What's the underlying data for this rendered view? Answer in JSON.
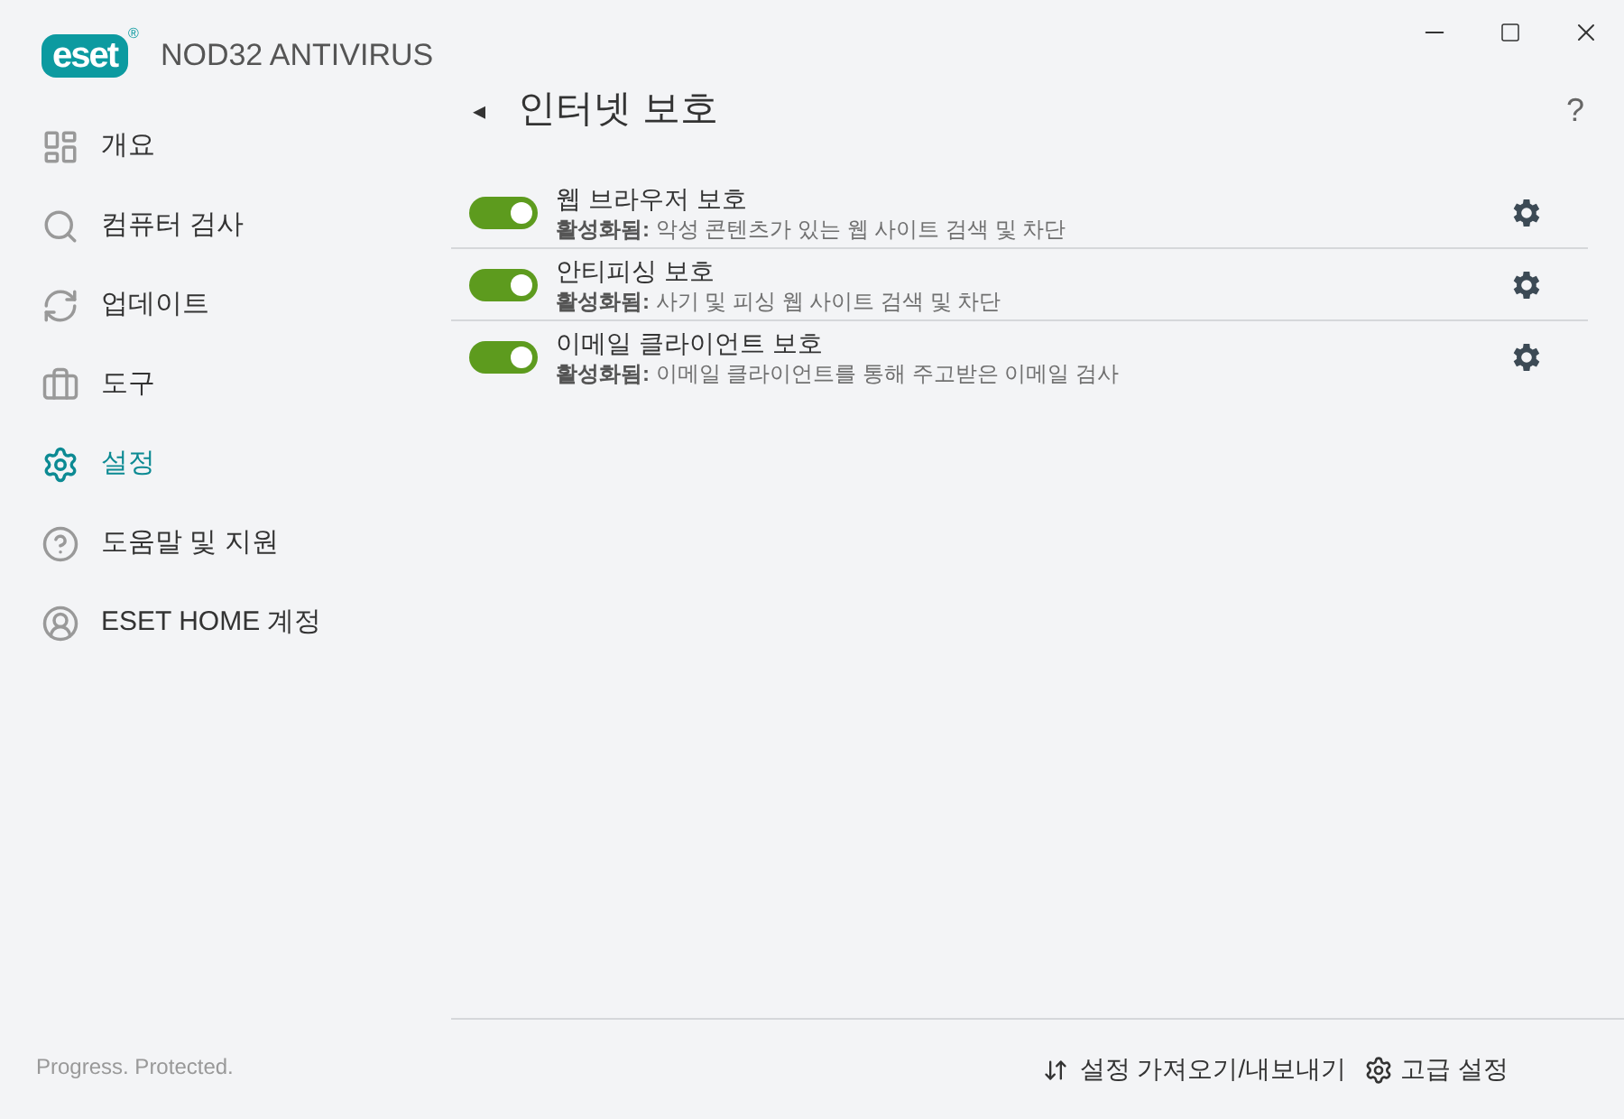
{
  "app": {
    "logo": "eset",
    "trademark": "®",
    "product": "NOD32 ANTIVIRUS"
  },
  "sidebar": {
    "items": [
      {
        "label": "개요",
        "kind": "overview",
        "selected": false
      },
      {
        "label": "컴퓨터 검사",
        "kind": "search",
        "selected": false
      },
      {
        "label": "업데이트",
        "kind": "refresh",
        "selected": false
      },
      {
        "label": "도구",
        "kind": "tools",
        "selected": false
      },
      {
        "label": "설정",
        "kind": "gear",
        "selected": true
      },
      {
        "label": "도움말 및 지원",
        "kind": "help",
        "selected": false
      },
      {
        "label": "ESET HOME 계정",
        "kind": "account",
        "selected": false
      }
    ],
    "tagline": "Progress. Protected."
  },
  "page": {
    "back": "◂",
    "title": "인터넷 보호",
    "help": "?"
  },
  "settings": [
    {
      "title": "웹 브라우저 보호",
      "description": "**활성화됨:** 악성 콘텐츠가 있는 웹 사이트 검색 및 차단",
      "on": true
    },
    {
      "title": "안티피싱 보호",
      "description": "**활성화됨:** 사기 및 피싱 웹 사이트 검색 및 차단",
      "on": true
    },
    {
      "title": "이메일 클라이언트 보호",
      "description": "**활성화됨:** 이메일 클라이언트를 통해 주고받은 이메일 검사",
      "on": true
    }
  ],
  "footer": {
    "import_export": "설정 가져오기/내보내기",
    "advanced": "고급 설정"
  }
}
